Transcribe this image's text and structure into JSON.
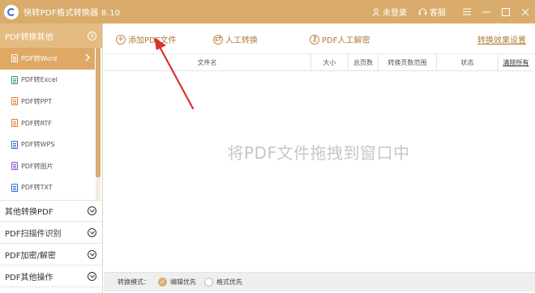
{
  "app": {
    "title": "快转PDF格式转换器 8.10",
    "accent": "#d9ac6c"
  },
  "titlebar": {
    "login_label": "未登录",
    "service_label": "客服"
  },
  "sidebar": {
    "group_active": "PDF转换其他",
    "sub_items": [
      {
        "label": "PDF转Word",
        "icon": "word-file-icon",
        "color": "#2b6fd6",
        "active": true
      },
      {
        "label": "PDF转Excel",
        "icon": "excel-file-icon",
        "color": "#2e9e4f"
      },
      {
        "label": "PDF转PPT",
        "icon": "ppt-file-icon",
        "color": "#e07a2c"
      },
      {
        "label": "PDF转RTF",
        "icon": "rtf-file-icon",
        "color": "#e07a2c"
      },
      {
        "label": "PDF转WPS",
        "icon": "wps-file-icon",
        "color": "#2b6fd6"
      },
      {
        "label": "PDF转图片",
        "icon": "image-file-icon",
        "color": "#8b46c7"
      },
      {
        "label": "PDF转TXT",
        "icon": "txt-file-icon",
        "color": "#2b6fd6"
      }
    ],
    "groups": [
      "其他转换PDF",
      "PDF扫描件识别",
      "PDF加密/解密",
      "PDF其他操作"
    ]
  },
  "toolbar": {
    "add_label": "添加PDF文件",
    "manual_label": "人工转换",
    "decrypt_label": "PDF人工解密",
    "settings_label": "转换效果设置"
  },
  "table": {
    "columns": [
      "文件名",
      "大小",
      "总页数",
      "转换页数范围",
      "状态",
      "清除所有"
    ]
  },
  "dropzone": {
    "text": "将PDF文件拖拽到窗口中"
  },
  "bottombar": {
    "mode_label": "转换模式：",
    "options": [
      {
        "label": "编辑优先",
        "checked": true
      },
      {
        "label": "格式优先",
        "checked": false
      }
    ]
  }
}
